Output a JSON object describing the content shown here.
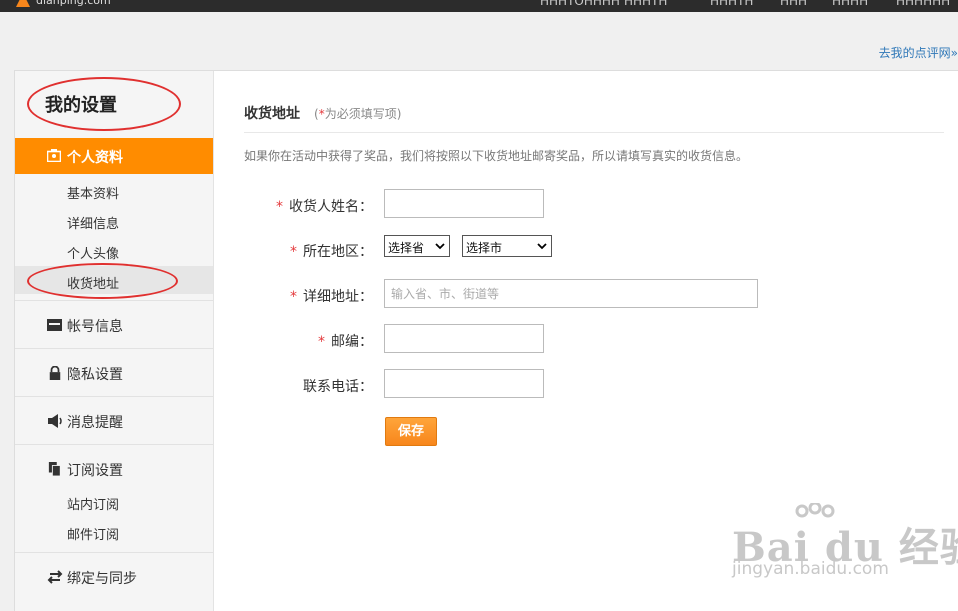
{
  "topbar": {
    "logo_text": "dianping.com",
    "nav": [
      "HHHTOHHHH",
      "HHHTH",
      "HHHTH",
      "HHH",
      "HHHH",
      "HHHHHH"
    ]
  },
  "header_link": "去我的点评网»",
  "sidebar": {
    "title": "我的设置",
    "active_section": "个人资料",
    "sub_items": [
      "基本资料",
      "详细信息",
      "个人头像",
      "收货地址"
    ],
    "sections": [
      {
        "label": "帐号信息",
        "icon": "id-card-icon"
      },
      {
        "label": "隐私设置",
        "icon": "lock-icon"
      },
      {
        "label": "消息提醒",
        "icon": "speaker-icon"
      },
      {
        "label": "订阅设置",
        "icon": "documents-icon"
      },
      {
        "label": "绑定与同步",
        "icon": "sync-arrows-icon"
      }
    ],
    "subscribe_items": [
      "站内订阅",
      "邮件订阅"
    ]
  },
  "main": {
    "title": "收货地址",
    "required_note_prefix": "(",
    "required_note_star": "*",
    "required_note_text": "为必须填写项)",
    "intro": "如果你在活动中获得了奖品，我们将按照以下收货地址邮寄奖品，所以请填写真实的收货信息。",
    "fields": {
      "name_label": "收货人姓名：",
      "region_label": "所在地区：",
      "province_value": "选择省",
      "city_value": "选择市",
      "address_label": "详细地址：",
      "address_placeholder": "输入省、市、街道等",
      "zip_label": "邮编：",
      "phone_label": "联系电话："
    },
    "required_mark": "*",
    "save_label": "保存"
  },
  "watermark": {
    "brand": "Bai du 经验",
    "url": "jingyan.baidu.com"
  },
  "colors": {
    "accent": "#ff8c00",
    "annotation_ring": "#e0302f",
    "link": "#2f78b8",
    "required": "#e4393c"
  }
}
